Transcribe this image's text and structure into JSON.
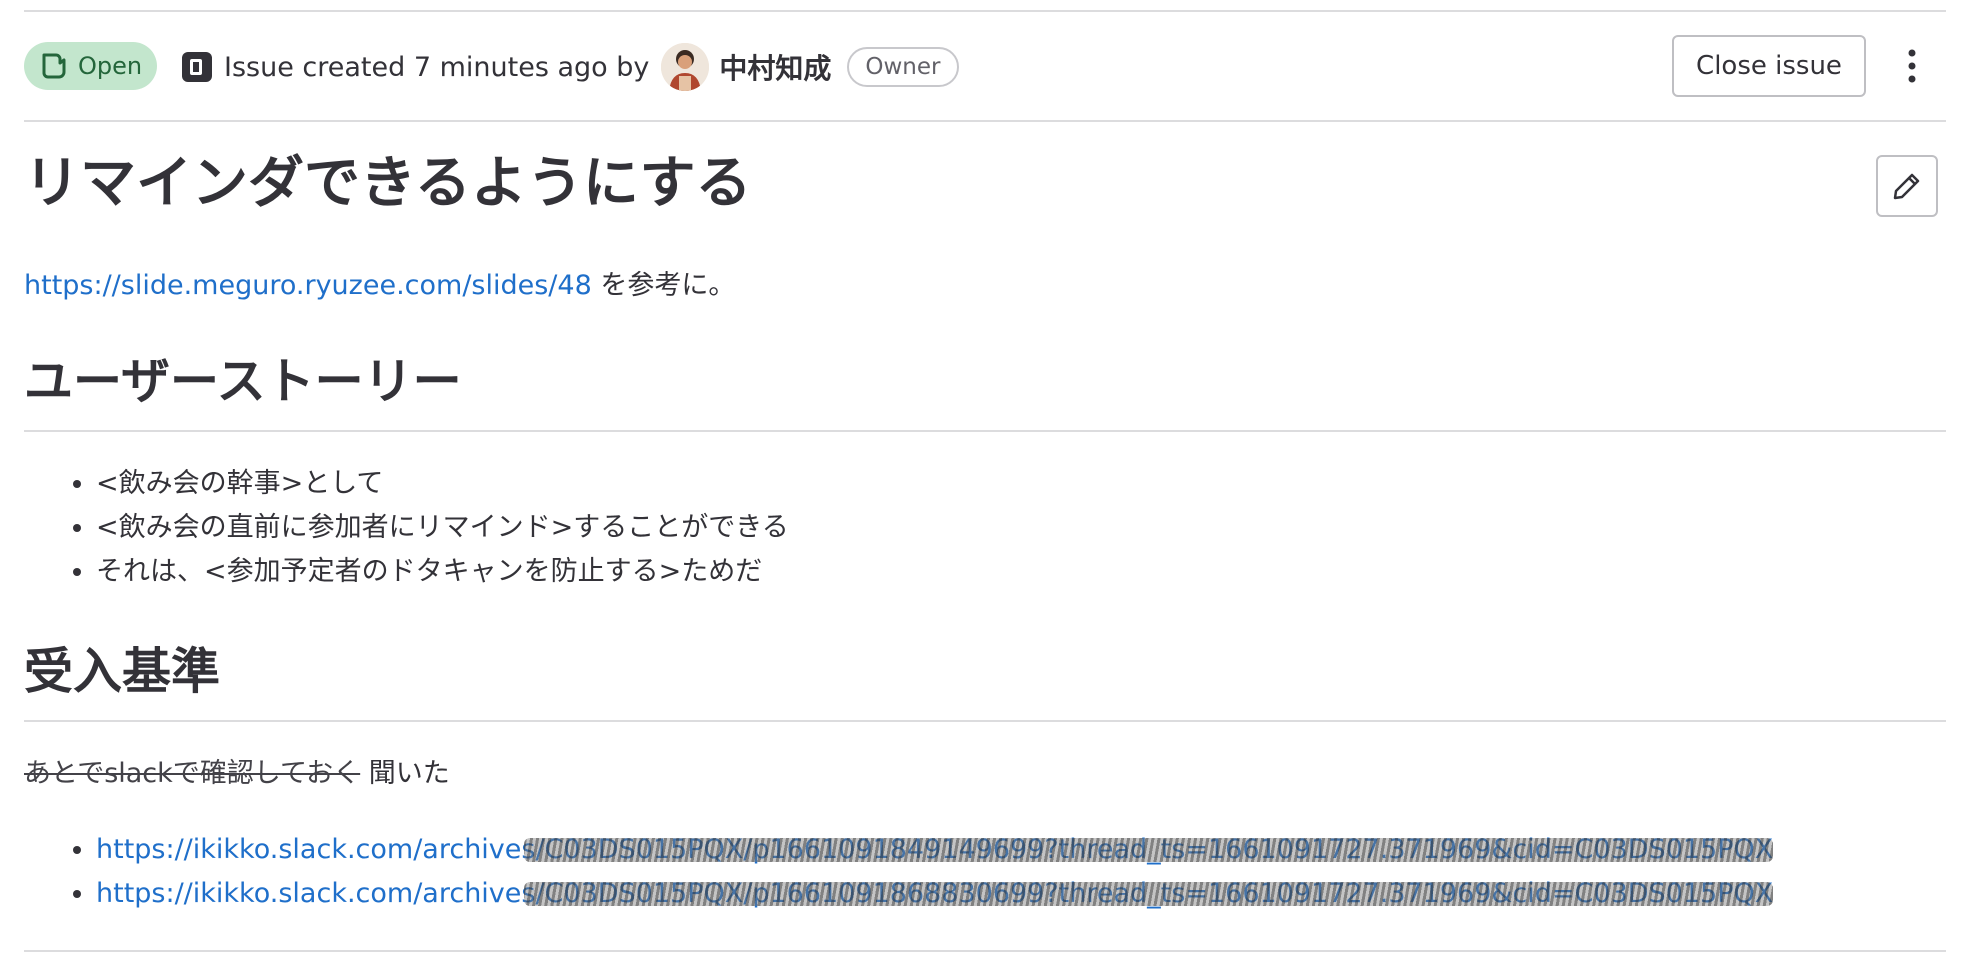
{
  "header": {
    "status": "Open",
    "meta_text": "Issue created 7 minutes ago by",
    "author": "中村知成",
    "role": "Owner",
    "close_button": "Close issue"
  },
  "issue": {
    "title": "リマインダできるようにする",
    "reference_link": "https://slide.meguro.ryuzee.com/slides/48",
    "reference_suffix": " を参考に。",
    "user_story": {
      "heading": "ユーザーストーリー",
      "items": [
        "<飲み会の幹事>として",
        "<飲み会の直前に参加者にリマインド>することができる",
        "それは、<参加予定者のドタキャンを防止する>ためだ"
      ]
    },
    "acceptance": {
      "heading": "受入基準",
      "struck_text": "あとでslackで確認しておく",
      "note": " 聞いた",
      "links": [
        "https://ikikko.slack.com/archives/C03DS015PQX/p1661091849149699?thread_ts=1661091727.371969&cid=C03DS015PQX",
        "https://ikikko.slack.com/archives/C03DS015PQX/p1661091868830699?thread_ts=1661091727.371969&cid=C03DS015PQX"
      ]
    }
  },
  "icons": {
    "status": "issue-open-icon",
    "meta": "issue-type-icon",
    "more": "kebab-menu-icon",
    "edit": "pencil-icon"
  },
  "colors": {
    "open_badge_bg": "#c3e6cd",
    "open_badge_text": "#24663b",
    "link": "#1f6fca"
  }
}
